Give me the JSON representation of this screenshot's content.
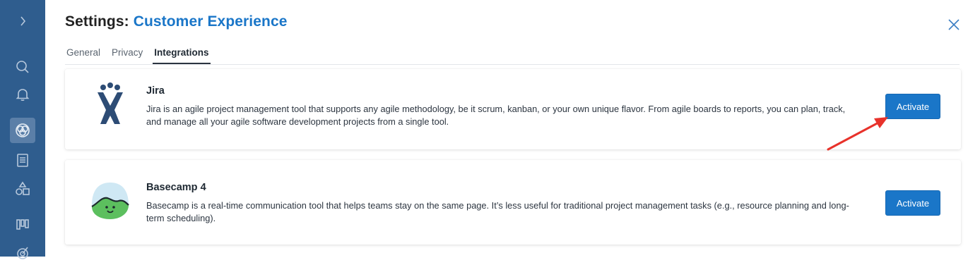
{
  "header": {
    "title_prefix": "Settings:",
    "title_accent": "Customer Experience"
  },
  "tabs": [
    {
      "label": "General"
    },
    {
      "label": "Privacy"
    },
    {
      "label": "Integrations",
      "active": true
    }
  ],
  "integrations": [
    {
      "name": "Jira",
      "description": "Jira is an agile project management tool that supports any agile methodology, be it scrum, kanban, or your own unique flavor. From agile boards to reports, you can plan, track, and manage all your agile software development projects from a single tool.",
      "button_label": "Activate",
      "logo_icon": "jira-logo-icon"
    },
    {
      "name": "Basecamp 4",
      "description": "Basecamp is a real-time communication tool that helps teams stay on the same page. It’s less useful for traditional project management tasks (e.g., resource planning and long-term scheduling).",
      "button_label": "Activate",
      "logo_icon": "basecamp-logo-icon"
    }
  ],
  "sidebar": {
    "items": [
      "expand-chevron-icon",
      "search-icon",
      "bell-icon",
      "integrations-icon",
      "document-icon",
      "shapes-icon",
      "board-icon",
      "target-icon"
    ]
  },
  "colors": {
    "sidebar_bg": "#2f5d8e",
    "accent": "#1a76c8",
    "annotation_arrow": "#e8322b"
  }
}
